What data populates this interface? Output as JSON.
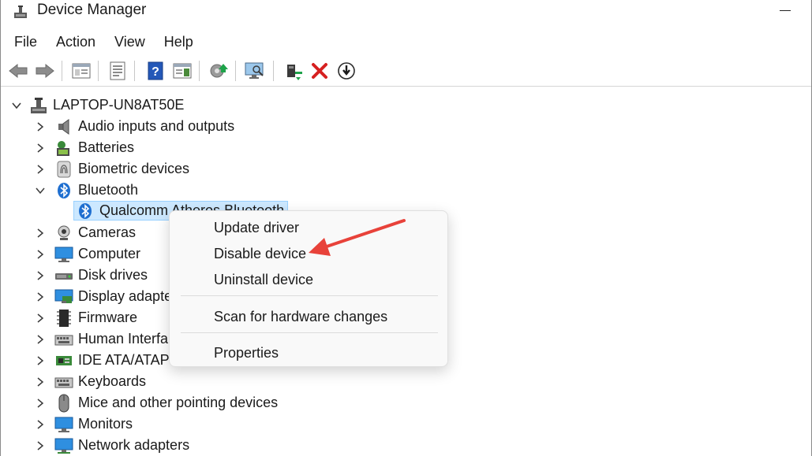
{
  "window": {
    "title": "Device Manager"
  },
  "menu": [
    "File",
    "Action",
    "View",
    "Help"
  ],
  "toolbar": {
    "buttons": [
      "back-arrow-icon",
      "forward-arrow-icon",
      "show-hide-console-tree-icon",
      "properties-icon",
      "help-icon",
      "action-pane-icon",
      "update-driver-icon",
      "scan-hardware-icon",
      "enable-device-icon",
      "uninstall-device-icon",
      "disable-device-icon"
    ],
    "colors": {
      "uninstall_red": "#d62020",
      "green_arrow": "#1ea34a",
      "blue_help": "#2458b8"
    }
  },
  "tree": {
    "root": "LAPTOP-UN8AT50E",
    "items": [
      {
        "label": "Audio inputs and outputs",
        "icon": "speaker-icon",
        "expanded": false
      },
      {
        "label": "Batteries",
        "icon": "battery-icon",
        "expanded": false
      },
      {
        "label": "Biometric devices",
        "icon": "fingerprint-icon",
        "expanded": false
      },
      {
        "label": "Bluetooth",
        "icon": "bluetooth-icon",
        "expanded": true
      },
      {
        "label": "Qualcomm Atheros Bluetooth",
        "icon": "bluetooth-icon",
        "child": true,
        "selected": true
      },
      {
        "label": "Cameras",
        "icon": "camera-icon",
        "expanded": false
      },
      {
        "label": "Computer",
        "icon": "monitor-icon",
        "expanded": false
      },
      {
        "label": "Disk drives",
        "icon": "disk-drive-icon",
        "expanded": false
      },
      {
        "label": "Display adapte",
        "icon": "display-adapter-icon",
        "expanded": false
      },
      {
        "label": "Firmware",
        "icon": "chip-icon",
        "expanded": false
      },
      {
        "label": "Human Interfa",
        "icon": "keyboard-icon",
        "expanded": false
      },
      {
        "label": "IDE ATA/ATAPI c",
        "icon": "ide-controller-icon",
        "expanded": false
      },
      {
        "label": "Keyboards",
        "icon": "keyboard-icon",
        "expanded": false
      },
      {
        "label": "Mice and other pointing devices",
        "icon": "mouse-icon",
        "expanded": false
      },
      {
        "label": "Monitors",
        "icon": "monitor-icon",
        "expanded": false
      },
      {
        "label": "Network adapters",
        "icon": "network-adapter-icon",
        "expanded": false
      }
    ]
  },
  "context_menu": {
    "items": [
      "Update driver",
      "Disable device",
      "Uninstall device",
      "Scan for hardware changes",
      "Properties"
    ]
  },
  "annotation": {
    "arrow_color": "#e8423a"
  }
}
